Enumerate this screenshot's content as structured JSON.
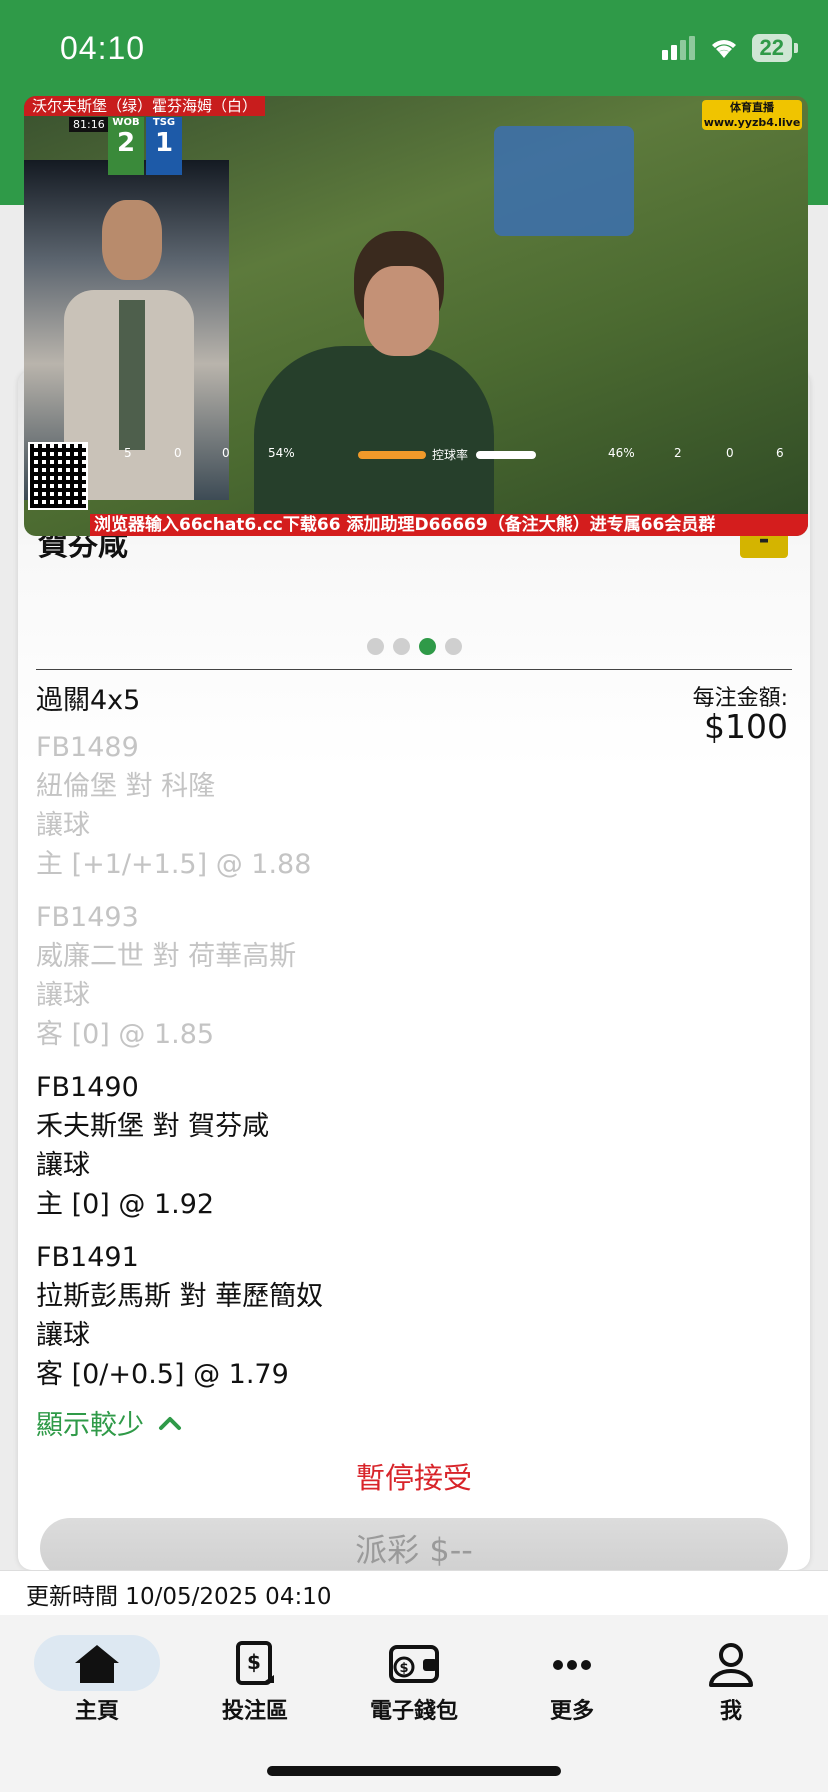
{
  "status_bar": {
    "time": "04:10",
    "battery": "22"
  },
  "card": {
    "title": "賀芬咸",
    "collapse_symbol": "-",
    "carousel": {
      "total": 4,
      "active": 3
    },
    "bet_type": "過關4x5",
    "stake_label": "每注金額:",
    "stake_value": "$100",
    "legs": [
      {
        "code": "FB1489",
        "match": "紐倫堡 對 科隆",
        "market": "讓球",
        "selection": "主 [+1/+1.5] @ 1.88",
        "faded": true
      },
      {
        "code": "FB1493",
        "match": "威廉二世 對 荷華高斯",
        "market": "讓球",
        "selection": "客 [0] @ 1.85",
        "faded": true
      },
      {
        "code": "FB1490",
        "match": "禾夫斯堡 對 賀芬咸",
        "market": "讓球",
        "selection": "主 [0] @ 1.92",
        "faded": false
      },
      {
        "code": "FB1491",
        "match": "拉斯彭馬斯 對 華歷簡奴",
        "market": "讓球",
        "selection": "客 [0/+0.5] @ 1.79",
        "faded": false
      }
    ],
    "show_less": "顯示較少",
    "status": "暫停接受",
    "payout_button": "派彩 $--"
  },
  "video": {
    "title": "沃尔夫斯堡（绿）霍芬海姆（白）",
    "clock": "81:16",
    "home_abbr": "WOB",
    "home_score": "2",
    "away_abbr": "TSG",
    "away_score": "1",
    "logo_text": "体育直播",
    "logo_url": "www.yyzb4.live",
    "stats": {
      "home_corners": "5",
      "home_red": "0",
      "home_yellow": "0",
      "home_possession": "54%",
      "possession_label": "控球率",
      "away_possession": "46%",
      "away_yellow": "2",
      "away_red": "0",
      "away_corners": "6"
    },
    "ticker": "浏览器输入66chat6.cc下载66 添加助理D66669（备注大熊）进专属66会员群"
  },
  "update_bar": {
    "text": "更新時間 10/05/2025 04:10"
  },
  "tabs": [
    {
      "label": "主頁",
      "icon": "home-icon",
      "active": true
    },
    {
      "label": "投注區",
      "icon": "betslip-icon",
      "active": false
    },
    {
      "label": "電子錢包",
      "icon": "wallet-icon",
      "active": false
    },
    {
      "label": "更多",
      "icon": "more-icon",
      "active": false
    },
    {
      "label": "我",
      "icon": "profile-icon",
      "active": false
    }
  ],
  "colors": {
    "brand_green": "#2f9a48",
    "alert_red": "#d8242a",
    "accent_yellow": "#d4b400"
  }
}
